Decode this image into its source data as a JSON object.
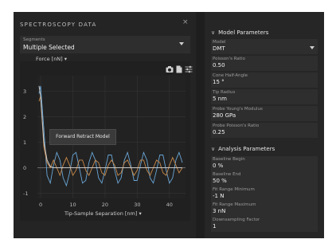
{
  "left_panel": {
    "title": "SPECTROSCOPY DATA",
    "close_glyph": "×",
    "segments": {
      "label": "Segments",
      "value": "Multiple Selected"
    },
    "y_axis_selector": "Force [nN]",
    "x_axis_selector": "Tip-Sample Separation [nm]",
    "tooltip": "Forward Retract Model",
    "icons": [
      "camera-icon",
      "export-icon",
      "settings-sliders-icon"
    ]
  },
  "model_parameters": {
    "header": "Model Parameters",
    "fields": [
      {
        "label": "Model",
        "value": "DMT",
        "dropdown": true
      },
      {
        "label": "Poisson's Ratio",
        "value": "0.50"
      },
      {
        "label": "Cone Half-Angle",
        "value": "15 °"
      },
      {
        "label": "Tip Radius",
        "value": "5 nm"
      },
      {
        "label": "Probe Young's Modulus",
        "value": "280 GPa"
      },
      {
        "label": "Probe Poisson's Ratio",
        "value": "0.25"
      }
    ]
  },
  "analysis_parameters": {
    "header": "Analysis Parameters",
    "fields": [
      {
        "label": "Baseline Begin",
        "value": "0 %"
      },
      {
        "label": "Baseline End",
        "value": "50 %"
      },
      {
        "label": "Fit Range Minimum",
        "value": "-1 N"
      },
      {
        "label": "Fit Range Maximum",
        "value": "3 nN"
      },
      {
        "label": "Downsampling Factor",
        "value": "1"
      }
    ]
  },
  "chart_data": {
    "type": "line",
    "title": "",
    "xlabel": "Tip-Sample Separation [nm]",
    "ylabel": "Force [nN]",
    "xlim": [
      -1,
      45
    ],
    "ylim": [
      -1.2,
      3.6
    ],
    "x_ticks": [
      0,
      10,
      20,
      30,
      40
    ],
    "y_ticks": [
      -1,
      0,
      1,
      2,
      3
    ],
    "grid": true,
    "series": [
      {
        "color": "#6aa6d6",
        "x": [
          -0.5,
          0,
          1,
          2,
          3,
          4,
          5,
          6,
          7,
          8,
          9,
          10,
          11,
          12,
          13,
          14,
          15,
          16,
          17,
          18,
          19,
          20,
          21,
          22,
          23,
          24,
          25,
          26,
          27,
          28,
          29,
          30,
          31,
          32,
          33,
          34,
          35,
          36,
          37,
          38,
          39,
          40,
          41,
          42,
          43,
          44
        ],
        "y": [
          2.9,
          3.2,
          1.5,
          -0.3,
          -0.6,
          0.1,
          0.6,
          0.3,
          -0.4,
          -0.7,
          -0.2,
          0.5,
          0.6,
          0.0,
          -0.6,
          -0.5,
          0.2,
          0.6,
          0.3,
          -0.4,
          -0.6,
          -0.1,
          0.5,
          0.5,
          -0.1,
          -0.6,
          -0.4,
          0.3,
          0.6,
          0.1,
          -0.5,
          -0.5,
          0.1,
          0.6,
          0.3,
          -0.4,
          -0.6,
          -0.1,
          0.5,
          0.5,
          -0.1,
          -0.6,
          -0.4,
          0.3,
          0.6,
          0.2
        ]
      },
      {
        "color": "#c98a4a",
        "x": [
          -0.5,
          0,
          1,
          2,
          3,
          4,
          5,
          6,
          7,
          8,
          9,
          10,
          11,
          12,
          13,
          14,
          15,
          16,
          17,
          18,
          19,
          20,
          21,
          22,
          23,
          24,
          25,
          26,
          27,
          28,
          29,
          30,
          31,
          32,
          33,
          34,
          35,
          36,
          37,
          38,
          39,
          40,
          41,
          42,
          43,
          44
        ],
        "y": [
          2.6,
          2.8,
          0.8,
          0.2,
          0.0,
          0.3,
          0.0,
          -0.3,
          0.1,
          0.4,
          0.1,
          -0.3,
          -0.1,
          0.3,
          0.3,
          -0.1,
          -0.3,
          0.0,
          0.3,
          0.2,
          -0.2,
          -0.3,
          0.1,
          0.3,
          0.1,
          -0.3,
          -0.2,
          0.2,
          0.3,
          0.0,
          -0.3,
          -0.1,
          0.3,
          0.3,
          -0.1,
          -0.3,
          0.0,
          0.3,
          0.2,
          -0.2,
          -0.3,
          0.1,
          0.4,
          0.1,
          -0.2,
          0.0
        ]
      },
      {
        "color": "#c8c8c8",
        "x": [
          -0.5,
          0,
          1,
          2,
          3,
          4,
          6,
          10,
          15,
          20,
          25,
          30,
          35,
          40,
          44
        ],
        "y": [
          3.2,
          2.8,
          1.0,
          0.3,
          0.05,
          0.0,
          0.0,
          0.0,
          0.0,
          0.0,
          0.0,
          0.0,
          0.0,
          0.0,
          0.0
        ]
      }
    ]
  }
}
